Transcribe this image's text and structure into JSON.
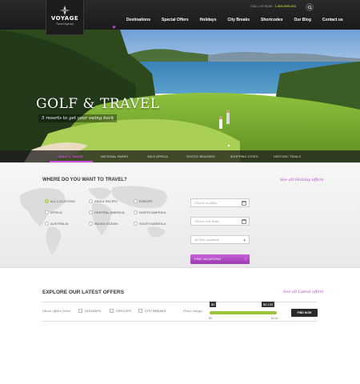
{
  "header": {
    "logo_text": "VOYAGE",
    "logo_sub": "Travel Agency",
    "call_label": "CALL US NOW:",
    "call_number": "1-800-555-453",
    "nav": [
      "Destinations",
      "Special Offers",
      "Holidays",
      "City Breaks",
      "Shortcodes",
      "Our Blog",
      "Contact us"
    ]
  },
  "hero": {
    "title": "GOLF & TRAVEL",
    "tagline": "5 resorts to get your swing back",
    "tabs": [
      "GOLF & TRAVEL",
      "NATIONAL PARKS",
      "WILD AFRICA",
      "EXOTIC BEACHES",
      "SHOPPING CITIES",
      "HISTORIC TRAILS"
    ],
    "active_tab": "GOLF & TRAVEL"
  },
  "search": {
    "title": "WHERE DO YOU WANT TO TRAVEL?",
    "see_link": "See all Holiday offers",
    "regions": [
      "ALL LOCATIONS",
      "ASIA & PACIFIC",
      "EUROPE",
      "AFRICA",
      "CENTRAL AMERICA",
      "NORTH AMERICA",
      "AUSTRALIA",
      "INDIAN OCEAN",
      "SOUTH AMERICA"
    ],
    "checkin_placeholder": "Check in date",
    "checkout_placeholder": "Check out date",
    "sublocation_value": "All Sub Locations",
    "find_label": "FIND VACATIONS"
  },
  "offers": {
    "title": "EXPLORE OUR LATEST OFFERS",
    "see_link": "See all Latest offers",
    "show_label": "Show offers from:",
    "filters": [
      "HOLIDAYS",
      "CIRCUITS",
      "CITY BREAKS"
    ],
    "price_label": "Price range:",
    "price_min": "$0",
    "price_max": "$4,100",
    "scale_min": "$0",
    "scale_max": "$4,1k",
    "find_now": "FIND NOW"
  },
  "colors": {
    "accent": "#b04ac4",
    "green": "#9ac53a",
    "dark": "#1a1a1a"
  }
}
